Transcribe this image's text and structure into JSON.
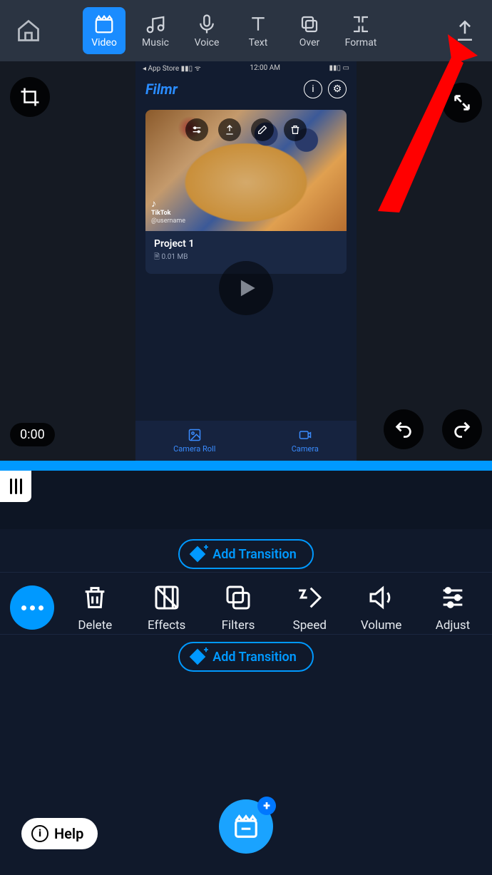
{
  "toolbar": {
    "tabs": [
      {
        "label": "Video",
        "icon": "clapperboard-icon",
        "active": true
      },
      {
        "label": "Music",
        "icon": "music-icon"
      },
      {
        "label": "Voice",
        "icon": "mic-icon"
      },
      {
        "label": "Text",
        "icon": "text-icon"
      },
      {
        "label": "Over",
        "icon": "overlay-icon"
      },
      {
        "label": "Format",
        "icon": "format-icon"
      }
    ]
  },
  "stage": {
    "time": "0:00",
    "phone": {
      "status_left": "◂ App Store  ▮▮▯  ᯤ",
      "status_time": "12:00 AM",
      "brand": "Filmr",
      "project_title": "Project 1",
      "project_size": "0.01 MB",
      "watermark_app": "TikTok",
      "watermark_user": "@username",
      "nav": {
        "roll": "Camera Roll",
        "camera": "Camera"
      }
    }
  },
  "transitions": {
    "label": "Add Transition"
  },
  "tools": [
    {
      "label": "Delete",
      "icon": "trash-icon"
    },
    {
      "label": "Effects",
      "icon": "effects-icon"
    },
    {
      "label": "Filters",
      "icon": "filters-icon"
    },
    {
      "label": "Speed",
      "icon": "speed-icon"
    },
    {
      "label": "Volume",
      "icon": "volume-icon"
    },
    {
      "label": "Adjust",
      "icon": "adjust-icon"
    }
  ],
  "help": {
    "label": "Help"
  }
}
